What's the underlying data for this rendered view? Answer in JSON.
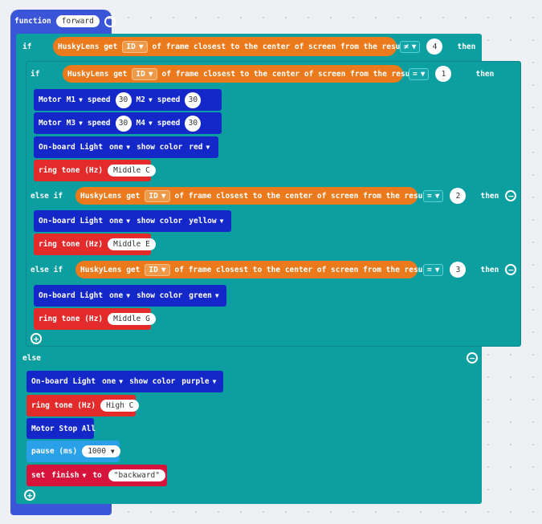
{
  "fn": {
    "keyword": "function",
    "name": "forward"
  },
  "kw": {
    "if": "if",
    "else_if": "else if",
    "else": "else",
    "then": "then"
  },
  "husky": {
    "prefix": "HuskyLens get",
    "field": "ID",
    "suffix": "of frame closest to the center of screen from the result"
  },
  "conditions": [
    {
      "op": "≠",
      "value": "4"
    },
    {
      "op": "=",
      "value": "1"
    },
    {
      "op": "=",
      "value": "2"
    },
    {
      "op": "=",
      "value": "3"
    }
  ],
  "motor": {
    "label": "Motor",
    "speed": "speed",
    "row1": {
      "m_a": "M1",
      "s_a": "30",
      "m_b": "M2",
      "s_b": "30"
    },
    "row2": {
      "m_a": "M3",
      "s_a": "30",
      "m_b": "M4",
      "s_b": "30"
    },
    "stop": "Motor Stop All"
  },
  "light": {
    "label": "On-board Light",
    "which": "one",
    "show": "show color",
    "colors": [
      "red",
      "yellow",
      "green",
      "purple"
    ]
  },
  "tone": {
    "label": "ring tone (Hz)",
    "notes": [
      "Middle C",
      "Middle E",
      "Middle G",
      "High C"
    ]
  },
  "pause": {
    "label": "pause (ms)",
    "value": "1000"
  },
  "set": {
    "label": "set",
    "var": "finish",
    "to": "to",
    "value": "\"backward\""
  },
  "icons": {
    "add": "+",
    "remove": "−",
    "collapse": "^"
  }
}
